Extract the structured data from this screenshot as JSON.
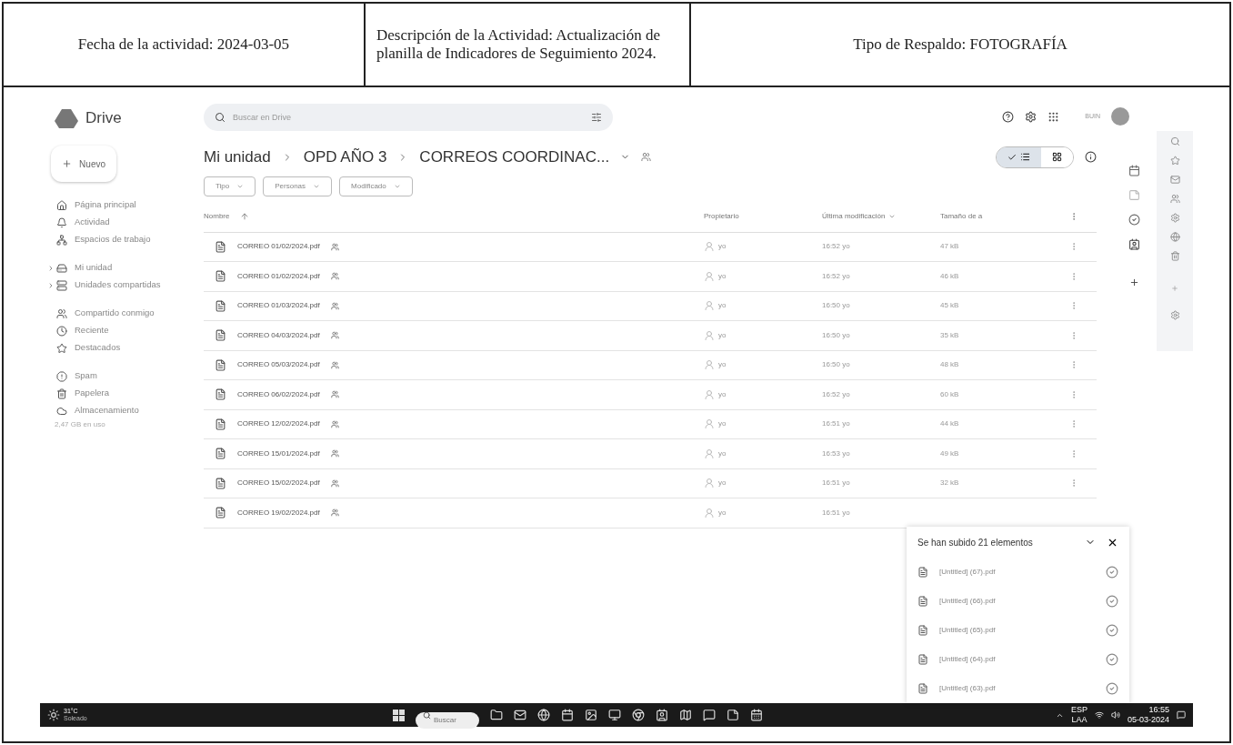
{
  "header_cells": [
    "Fecha de la actividad: 2024-03-05",
    "Descripción de la Actividad: Actualización de planilla de Indicadores de Seguimiento 2024.",
    "Tipo de Respaldo: FOTOGRAFÍA"
  ],
  "drive": {
    "app_name": "Drive",
    "search": {
      "placeholder": "Buscar en Drive"
    },
    "account_label": "BUIN",
    "new_button": "Nuevo",
    "nav_groups": [
      [
        {
          "label": "Página principal",
          "kind": "home",
          "expandable": false
        },
        {
          "label": "Actividad",
          "kind": "bell",
          "expandable": false
        },
        {
          "label": "Espacios de trabajo",
          "kind": "workspace",
          "expandable": false
        }
      ],
      [
        {
          "label": "Mi unidad",
          "kind": "drive",
          "expandable": true
        },
        {
          "label": "Unidades compartidas",
          "kind": "shared_drive",
          "expandable": true
        }
      ],
      [
        {
          "label": "Compartido conmigo",
          "kind": "people",
          "expandable": false
        },
        {
          "label": "Reciente",
          "kind": "clock",
          "expandable": false
        },
        {
          "label": "Destacados",
          "kind": "star",
          "expandable": false
        }
      ],
      [
        {
          "label": "Spam",
          "kind": "spam",
          "expandable": false
        },
        {
          "label": "Papelera",
          "kind": "trash",
          "expandable": false
        },
        {
          "label": "Almacenamiento",
          "kind": "cloud",
          "expandable": false
        }
      ]
    ],
    "storage_text": "2,47 GB en uso",
    "breadcrumb": [
      "Mi unidad",
      "OPD AÑO 3",
      "CORREOS COORDINAC..."
    ],
    "views": [
      {
        "kind": "list",
        "selected": true
      },
      {
        "kind": "grid",
        "selected": false
      }
    ],
    "filters": [
      "Tipo",
      "Personas",
      "Modificado"
    ],
    "columns": [
      "Nombre",
      "Propietario",
      "Última modificación",
      "Tamaño de a"
    ],
    "rows": [
      {
        "name": "CORREO 01/02/2024.pdf",
        "owner": "yo",
        "modified": "16:52 yo",
        "size": "47 kB"
      },
      {
        "name": "CORREO 01/02/2024.pdf",
        "owner": "yo",
        "modified": "16:52 yo",
        "size": "46 kB"
      },
      {
        "name": "CORREO 01/03/2024.pdf",
        "owner": "yo",
        "modified": "16:50 yo",
        "size": "45 kB"
      },
      {
        "name": "CORREO 04/03/2024.pdf",
        "owner": "yo",
        "modified": "16:50 yo",
        "size": "35 kB"
      },
      {
        "name": "CORREO 05/03/2024.pdf",
        "owner": "yo",
        "modified": "16:50 yo",
        "size": "48 kB"
      },
      {
        "name": "CORREO 06/02/2024.pdf",
        "owner": "yo",
        "modified": "16:52 yo",
        "size": "60 kB"
      },
      {
        "name": "CORREO 12/02/2024.pdf",
        "owner": "yo",
        "modified": "16:51 yo",
        "size": "44 kB"
      },
      {
        "name": "CORREO 15/01/2024.pdf",
        "owner": "yo",
        "modified": "16:53 yo",
        "size": "49 kB"
      },
      {
        "name": "CORREO 15/02/2024.pdf",
        "owner": "yo",
        "modified": "16:51 yo",
        "size": "32 kB"
      },
      {
        "name": "CORREO 19/02/2024.pdf",
        "owner": "yo",
        "modified": "16:51 yo"
      }
    ],
    "upload_panel": {
      "title": "Se han subido 21 elementos",
      "items": [
        "[Untitled] (67).pdf",
        "[Untitled] (66).pdf",
        "[Untitled] (65).pdf",
        "[Untitled] (64).pdf",
        "[Untitled] (63).pdf"
      ]
    }
  },
  "taskbar": {
    "temperature": "31°C",
    "weather": "Soleado",
    "search": {
      "placeholder": "Buscar"
    },
    "language": "ESP",
    "layout": "LAA",
    "time": "16:55",
    "date": "05-03-2024"
  }
}
